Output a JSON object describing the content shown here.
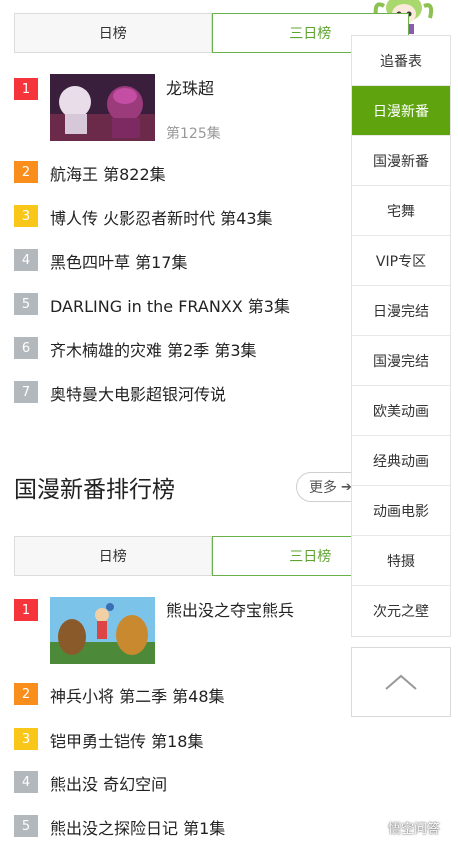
{
  "section1": {
    "tabs": [
      {
        "label": "日榜",
        "active": false
      },
      {
        "label": "三日榜",
        "active": true
      }
    ],
    "items": [
      {
        "rank": "1",
        "title": "龙珠超",
        "episode": "第125集"
      },
      {
        "rank": "2",
        "title": "航海王 第822集"
      },
      {
        "rank": "3",
        "title": "博人传 火影忍者新时代 第43集"
      },
      {
        "rank": "4",
        "title": "黑色四叶草 第17集"
      },
      {
        "rank": "5",
        "title": "DARLING in the FRANXX 第3集"
      },
      {
        "rank": "6",
        "title": "齐木楠雄的灾难 第2季 第3集"
      },
      {
        "rank": "7",
        "title": "奥特曼大电影超银河传说"
      }
    ]
  },
  "section2": {
    "title": "国漫新番排行榜",
    "more_label": "更多",
    "tabs": [
      {
        "label": "日榜",
        "active": false
      },
      {
        "label": "三日榜",
        "active": true
      }
    ],
    "items": [
      {
        "rank": "1",
        "title": "熊出没之夺宝熊兵"
      },
      {
        "rank": "2",
        "title": "神兵小将 第二季 第48集"
      },
      {
        "rank": "3",
        "title": "铠甲勇士铠传 第18集"
      },
      {
        "rank": "4",
        "title": "熊出没 奇幻空间"
      },
      {
        "rank": "5",
        "title": "熊出没之探险日记 第1集"
      }
    ]
  },
  "side_menu": {
    "active_index": 1,
    "items": [
      "追番表",
      "日漫新番",
      "国漫新番",
      "宅舞",
      "VIP专区",
      "日漫完结",
      "国漫完结",
      "欧美动画",
      "经典动画",
      "动画电影",
      "特摄",
      "次元之壁"
    ],
    "active_color": "#5fa40f"
  },
  "watermark": "悟空问答",
  "colors": {
    "accent_green": "#5fa431",
    "rank1": "#f5343b",
    "rank2": "#f98e1d",
    "rank3": "#f9c71a",
    "rank_other": "#b3b8bd"
  },
  "icons": {
    "more": "chevron-right-icon",
    "to_top": "chevron-up-icon",
    "watermark": "wukong-logo-icon"
  }
}
